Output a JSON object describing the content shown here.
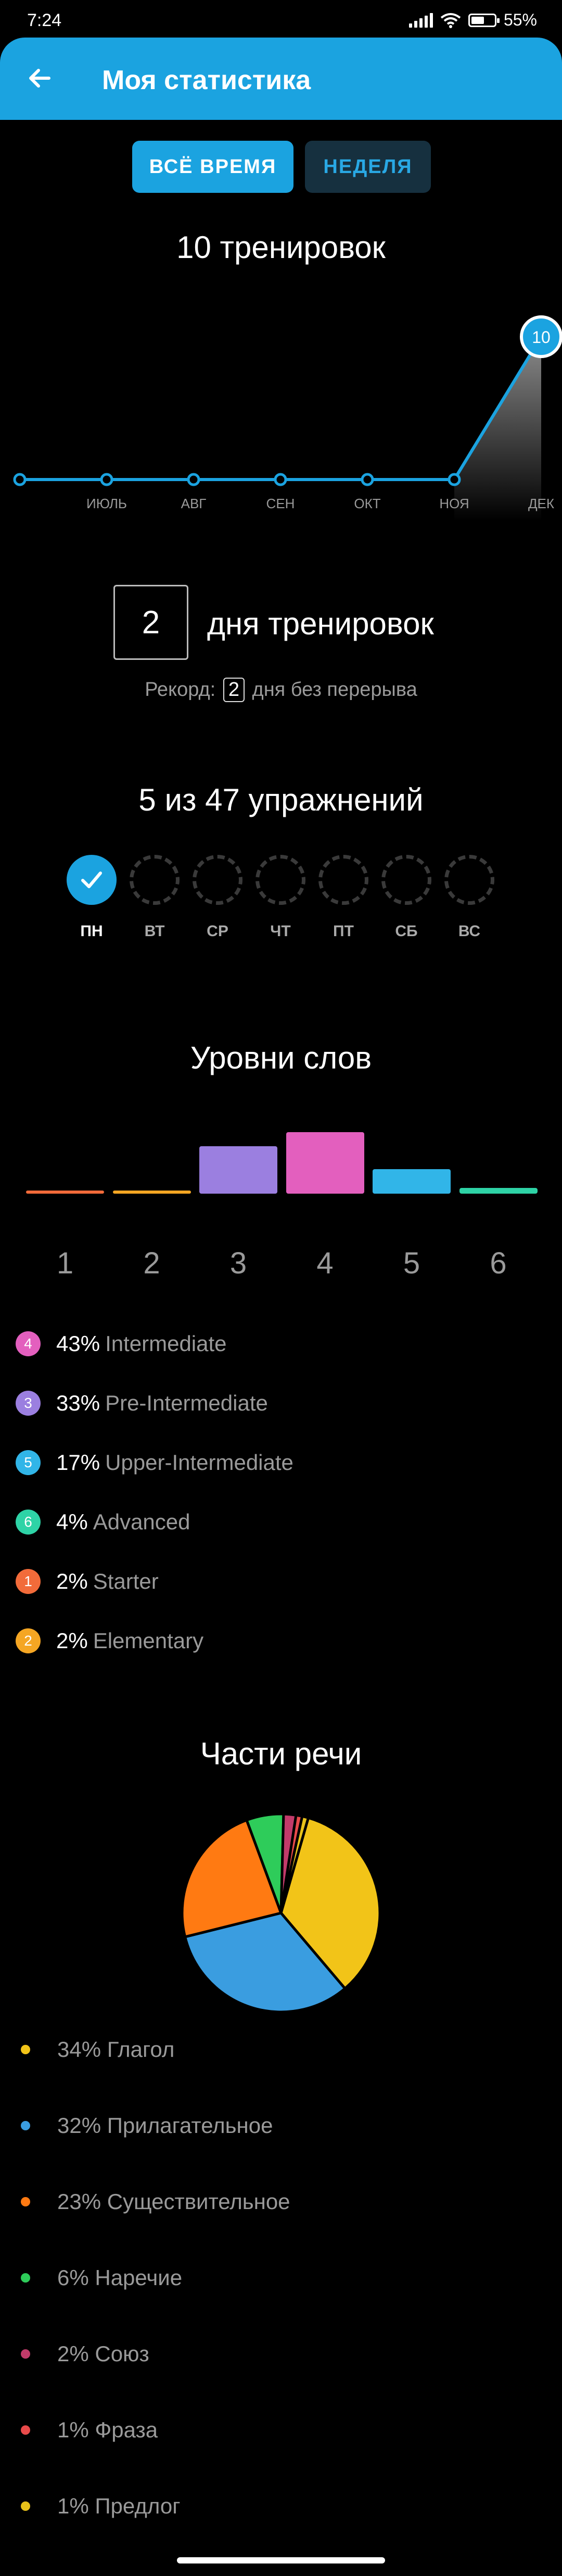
{
  "status_bar": {
    "time": "7:24",
    "battery": "55%",
    "battery_level": 0.55
  },
  "header": {
    "title": "Моя статистика"
  },
  "toggle": {
    "all_time": "ВСЁ ВРЕМЯ",
    "week": "НЕДЕЛЯ",
    "selected": "all_time"
  },
  "trainings": {
    "title": "10 тренировок"
  },
  "chart_data": {
    "type": "area",
    "categories": [
      "",
      "ИЮЛЬ",
      "АВГ",
      "СЕН",
      "ОКТ",
      "НОЯ",
      "ДЕК"
    ],
    "values": [
      0,
      0,
      0,
      0,
      0,
      0,
      10
    ],
    "highlight_label": "10",
    "line_color": "#1ba3e0"
  },
  "streak": {
    "value": "2",
    "label": "дня тренировок",
    "record_prefix": "Рекорд:",
    "record_value": "2",
    "record_suffix": "дня без перерыва"
  },
  "exercises": {
    "title": "5 из 47 упражнений",
    "days": [
      {
        "label": "ПН",
        "done": true
      },
      {
        "label": "ВТ",
        "done": false
      },
      {
        "label": "СР",
        "done": false
      },
      {
        "label": "ЧТ",
        "done": false
      },
      {
        "label": "ПТ",
        "done": false
      },
      {
        "label": "СБ",
        "done": false
      },
      {
        "label": "ВС",
        "done": false
      }
    ]
  },
  "word_levels": {
    "title": "Уровни слов",
    "bars": [
      {
        "label": "1",
        "percent": 2,
        "color": "#f26b3a"
      },
      {
        "label": "2",
        "percent": 2,
        "color": "#f5a623"
      },
      {
        "label": "3",
        "percent": 33,
        "color": "#9b7fe0"
      },
      {
        "label": "4",
        "percent": 43,
        "color": "#e35fbe"
      },
      {
        "label": "5",
        "percent": 17,
        "color": "#31b5e8"
      },
      {
        "label": "6",
        "percent": 4,
        "color": "#2ed3a6"
      }
    ],
    "legend": [
      {
        "num": "4",
        "pct": "43%",
        "name": "Intermediate",
        "color": "#e35fbe"
      },
      {
        "num": "3",
        "pct": "33%",
        "name": "Pre-Intermediate",
        "color": "#9b7fe0"
      },
      {
        "num": "5",
        "pct": "17%",
        "name": "Upper-Intermediate",
        "color": "#31b5e8"
      },
      {
        "num": "6",
        "pct": "4%",
        "name": "Advanced",
        "color": "#2ed3a6"
      },
      {
        "num": "1",
        "pct": "2%",
        "name": "Starter",
        "color": "#f26b3a"
      },
      {
        "num": "2",
        "pct": "2%",
        "name": "Elementary",
        "color": "#f5a623"
      }
    ]
  },
  "parts_of_speech": {
    "title": "Части речи",
    "items": [
      {
        "text": "34% Глагол",
        "percent": 34,
        "color": "#f2c418"
      },
      {
        "text": "32% Прилагательное",
        "percent": 32,
        "color": "#3a9de0"
      },
      {
        "text": "23% Существительное",
        "percent": 23,
        "color": "#ff7a12"
      },
      {
        "text": "6% Наречие",
        "percent": 6,
        "color": "#2ecc5a"
      },
      {
        "text": "2% Союз",
        "percent": 2,
        "color": "#c23b6a"
      },
      {
        "text": "1% Фраза",
        "percent": 1,
        "color": "#e84a4a"
      },
      {
        "text": "1% Предлог",
        "percent": 1,
        "color": "#e8c21a"
      }
    ]
  }
}
